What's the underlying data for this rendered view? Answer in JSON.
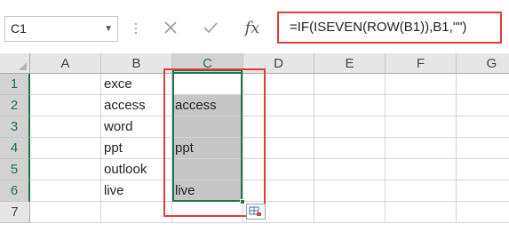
{
  "namebox": {
    "value": "C1"
  },
  "formula_bar": {
    "cancel_icon": "x-icon",
    "enter_icon": "check-icon",
    "function_label": "fx",
    "formula": "=IF(ISEVEN(ROW(B1)),B1,\"\")"
  },
  "columns": [
    "A",
    "B",
    "C",
    "D",
    "E",
    "F",
    "G"
  ],
  "rows": [
    "1",
    "2",
    "3",
    "4",
    "5",
    "6",
    "7"
  ],
  "column_b": [
    "exce",
    "access",
    "word",
    "ppt",
    "outlook",
    "live",
    ""
  ],
  "column_c": [
    "",
    "access",
    "",
    "ppt",
    "",
    "live",
    ""
  ],
  "colors": {
    "selection": "#217346",
    "highlight_box": "#e03c3c",
    "shaded_cells": "#c6c6c6"
  }
}
